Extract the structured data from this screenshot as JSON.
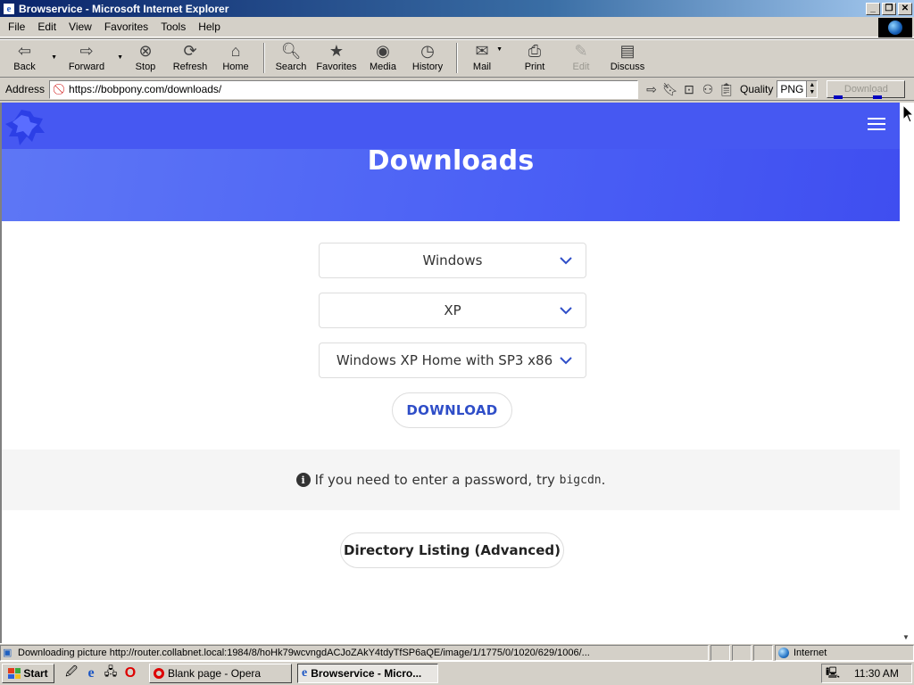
{
  "window": {
    "title": "Browservice - Microsoft Internet Explorer",
    "minimize": "_",
    "maximize": "❐",
    "close": "✕"
  },
  "menu": [
    "File",
    "Edit",
    "View",
    "Favorites",
    "Tools",
    "Help"
  ],
  "toolbar": {
    "back": "Back",
    "forward": "Forward",
    "stop": "Stop",
    "refresh": "Refresh",
    "home": "Home",
    "search": "Search",
    "favorites": "Favorites",
    "media": "Media",
    "history": "History",
    "mail": "Mail",
    "print": "Print",
    "edit": "Edit",
    "discuss": "Discuss"
  },
  "address": {
    "label": "Address",
    "url": "https://bobpony.com/downloads/",
    "quality_label": "Quality",
    "quality_value": "PNG",
    "download_label": "Download"
  },
  "page": {
    "heading": "Downloads",
    "select_os": "Windows",
    "select_version": "XP",
    "select_edition": "Windows XP Home with SP3 x86",
    "download_button": "DOWNLOAD",
    "info_prefix": "If you need to enter a password, try",
    "info_code": "bigcdn",
    "info_suffix": ".",
    "directory_button": "Directory Listing (Advanced)"
  },
  "colors": {
    "hero": "#4a5ff5",
    "accent": "#2f4ec8"
  },
  "status": {
    "text": "Downloading picture http://router.collabnet.local:1984/8/hoHk79wcvngdACJoZAkY4tdyTfSP6aQE/image/1/1775/0/1020/629/1006/...",
    "zone": "Internet"
  },
  "taskbar": {
    "start": "Start",
    "task1": "Blank page - Opera",
    "task2": "Browservice - Micro...",
    "clock": "11:30 AM"
  }
}
